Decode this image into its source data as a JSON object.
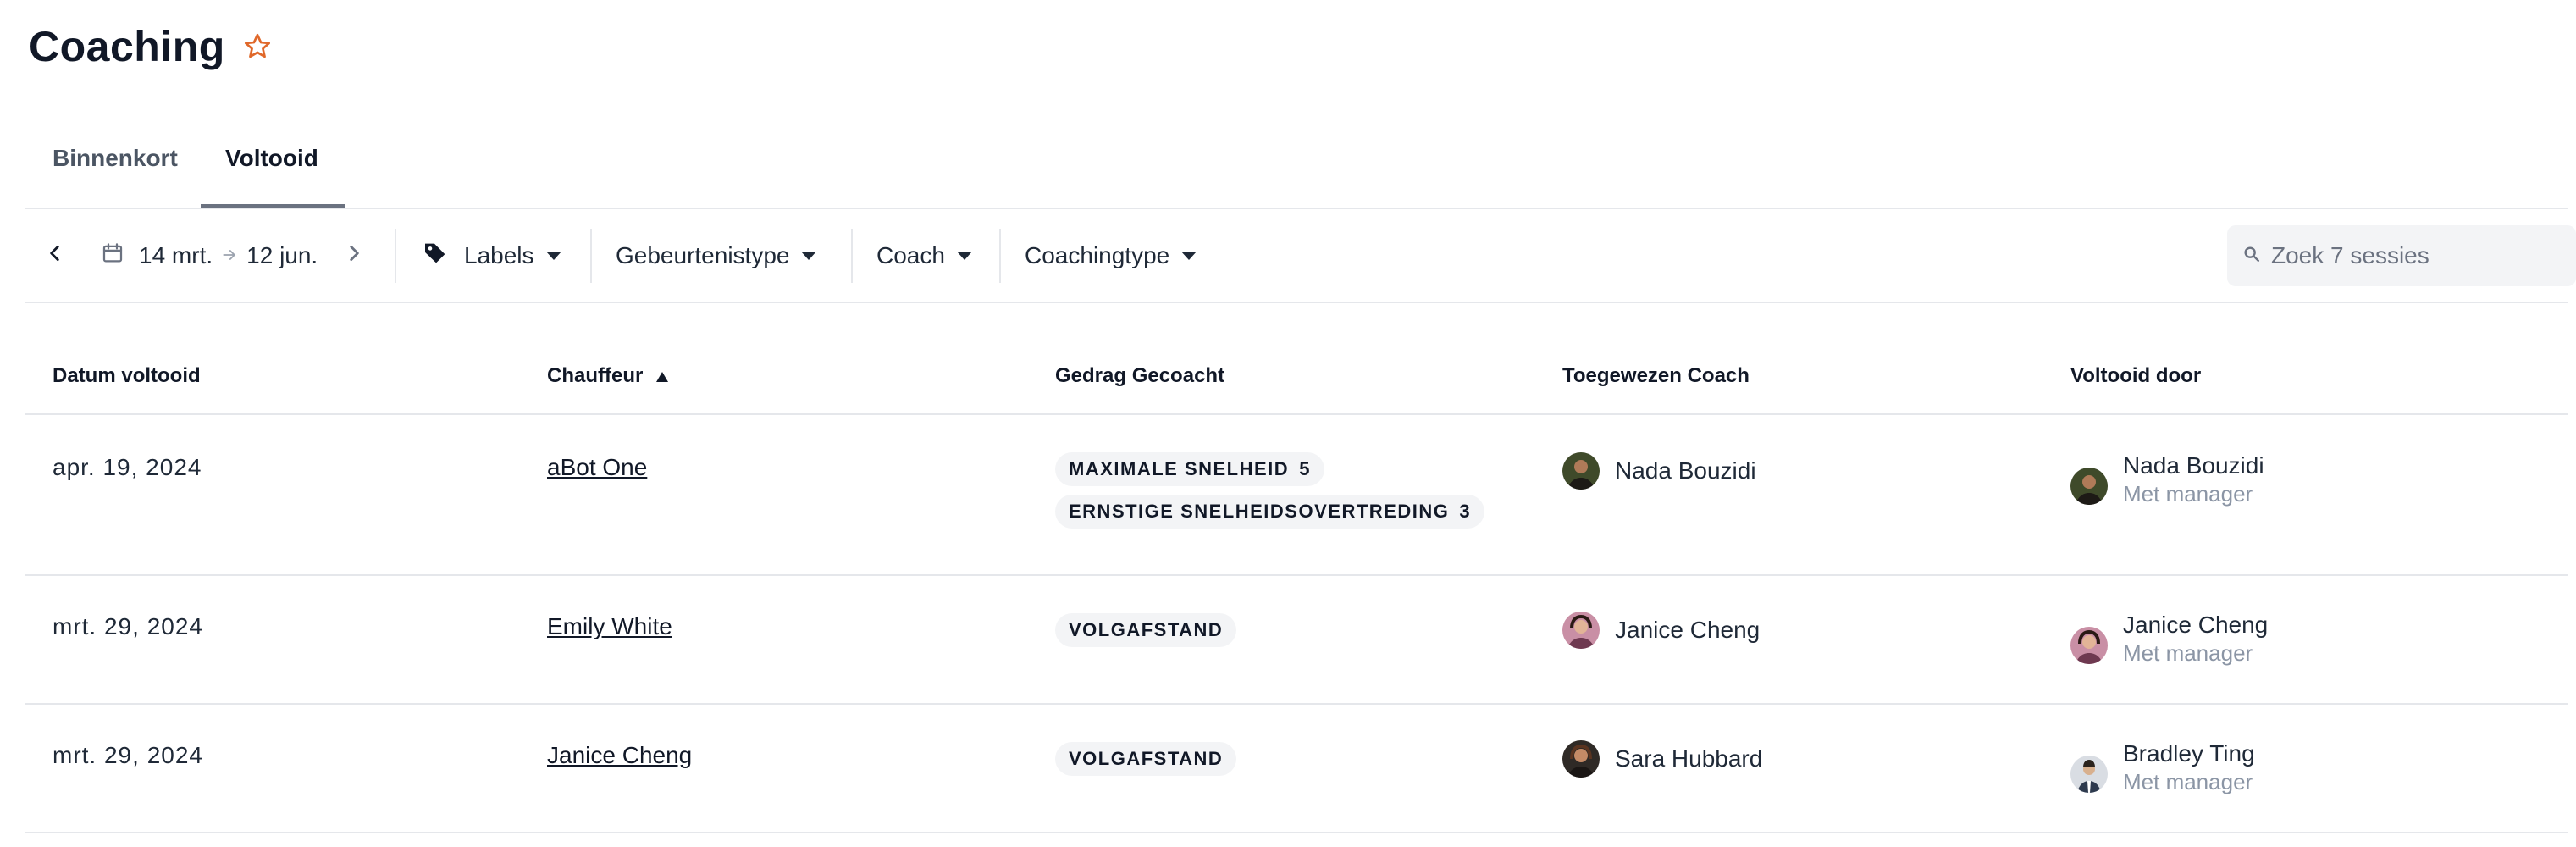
{
  "page": {
    "title": "Coaching"
  },
  "tabs": [
    {
      "label": "Binnenkort"
    },
    {
      "label": "Voltooid"
    }
  ],
  "filters": {
    "date_from": "14 mrt.",
    "date_to": "12 jun.",
    "labels": "Labels",
    "event_type": "Gebeurtenistype",
    "coach": "Coach",
    "coaching_type": "Coachingtype",
    "search_placeholder": "Zoek 7 sessies"
  },
  "table": {
    "columns": {
      "date": "Datum voltooid",
      "driver": "Chauffeur",
      "behavior": "Gedrag Gecoacht",
      "coach": "Toegewezen Coach",
      "completed_by": "Voltooid door"
    },
    "rows": [
      {
        "date": "apr. 19, 2024",
        "driver": "aBot One",
        "behaviors": [
          {
            "label": "MAXIMALE SNELHEID",
            "count": "5"
          },
          {
            "label": "ERNSTIGE SNELHEIDSOVERTREDING",
            "count": "3"
          }
        ],
        "coach": "Nada Bouzidi",
        "completed_by": "Nada Bouzidi",
        "completed_by_role": "Met manager"
      },
      {
        "date": "mrt. 29, 2024",
        "driver": "Emily White",
        "behaviors": [
          {
            "label": "VOLGAFSTAND"
          }
        ],
        "coach": "Janice Cheng",
        "completed_by": "Janice Cheng",
        "completed_by_role": "Met manager"
      },
      {
        "date": "mrt. 29, 2024",
        "driver": "Janice Cheng",
        "behaviors": [
          {
            "label": "VOLGAFSTAND"
          }
        ],
        "coach": "Sara Hubbard",
        "completed_by": "Bradley Ting",
        "completed_by_role": "Met manager"
      }
    ]
  },
  "colors": {
    "accent_star": "#e0682a",
    "pill_bg": "#f3f4f6",
    "muted_text": "#8b95a5"
  }
}
